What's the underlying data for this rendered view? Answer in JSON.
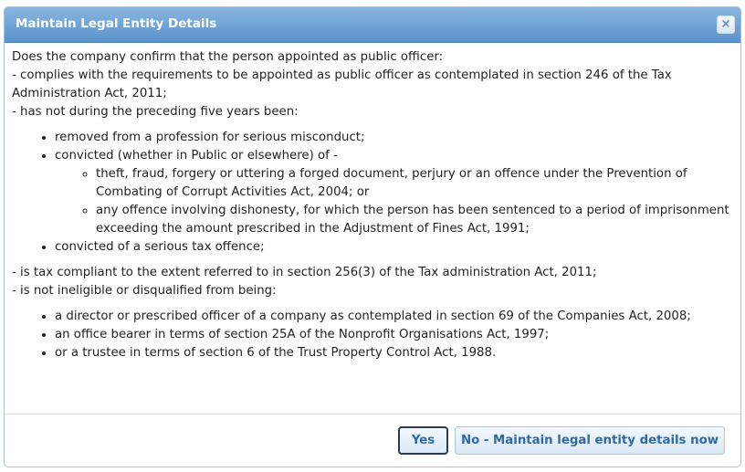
{
  "dialog": {
    "title": "Maintain Legal Entity Details",
    "close_icon": "close-icon",
    "close_glyph": "×"
  },
  "content": {
    "intro": "Does the company confirm that the person appointed as public officer:",
    "line1": "- complies with the requirements to be appointed as public officer as contemplated in section 246 of the Tax Administration Act, 2011;",
    "line2": "- has not during the preceding five years been:",
    "list1": [
      "removed from a profession for serious misconduct;",
      "convicted (whether in Public or elsewhere) of -",
      "convicted of a serious tax offence;"
    ],
    "sublist": [
      "theft, fraud, forgery or uttering a forged document, perjury or an offence under the Prevention of Combating of Corrupt Activities Act, 2004; or",
      "any offence involving dishonesty, for which the person has been sentenced to a period of imprisonment exceeding the amount prescribed in the Adjustment of Fines Act, 1991;"
    ],
    "line3": "- is tax compliant to the extent referred to in section 256(3) of the Tax administration Act, 2011;",
    "line4": "- is not ineligible or disqualified from being:",
    "list2": [
      "a director or prescribed officer of a company as contemplated in section 69 of the Companies Act, 2008;",
      "an office bearer in terms of section 25A of the Nonprofit Organisations Act, 1997;",
      "or a trustee in terms of section 6 of the Trust Property Control Act, 1988."
    ]
  },
  "buttons": {
    "yes": "Yes",
    "no": "No - Maintain legal entity details now"
  },
  "colors": {
    "titlebar": "#5a93cc",
    "title_text": "#ffffff",
    "button_text": "#2e6aa8",
    "body_text": "#222222"
  }
}
